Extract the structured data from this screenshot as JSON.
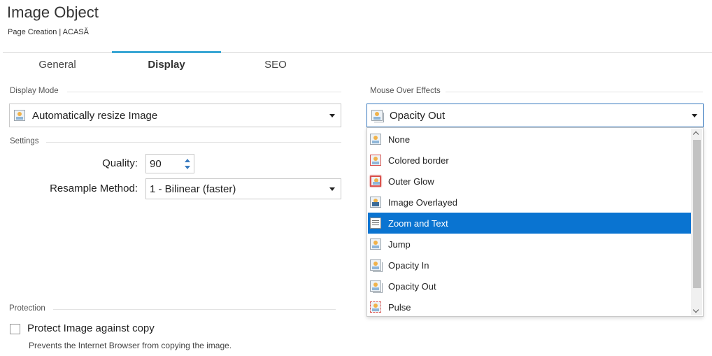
{
  "header": {
    "title": "Image Object",
    "subtitle": "Page Creation | ACASĂ"
  },
  "tabs": [
    {
      "label": "General",
      "active": false
    },
    {
      "label": "Display",
      "active": true
    },
    {
      "label": "SEO",
      "active": false
    }
  ],
  "display_mode": {
    "section_label": "Display Mode",
    "selected": "Automatically resize Image",
    "icon": "image-icon"
  },
  "settings": {
    "section_label": "Settings",
    "quality_label": "Quality:",
    "quality_value": "90",
    "resample_label": "Resample Method:",
    "resample_selected": "1 - Bilinear (faster)"
  },
  "mouse_over": {
    "section_label": "Mouse Over Effects",
    "selected": "Opacity Out",
    "options": [
      {
        "label": "None",
        "icon": "image-icon"
      },
      {
        "label": "Colored border",
        "icon": "colored-border-icon"
      },
      {
        "label": "Outer Glow",
        "icon": "outer-glow-icon"
      },
      {
        "label": "Image Overlayed",
        "icon": "image-overlayed-icon"
      },
      {
        "label": "Zoom and Text",
        "icon": "zoom-text-icon",
        "highlighted": true
      },
      {
        "label": "Jump",
        "icon": "jump-icon"
      },
      {
        "label": "Opacity In",
        "icon": "opacity-in-icon"
      },
      {
        "label": "Opacity Out",
        "icon": "opacity-out-icon"
      },
      {
        "label": "Pulse",
        "icon": "pulse-icon"
      }
    ]
  },
  "protection": {
    "section_label": "Protection",
    "checkbox_label": "Protect Image against copy",
    "checked": false,
    "hint": "Prevents the Internet Browser from copying the image."
  },
  "colors": {
    "accent": "#3aa6d4",
    "highlight": "#0a74d1"
  }
}
